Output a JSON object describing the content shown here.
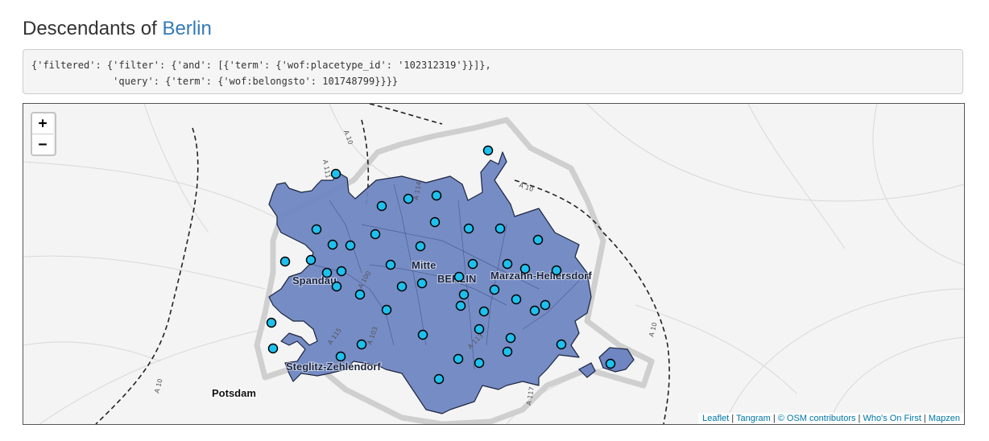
{
  "heading": {
    "prefix": "Descendants of ",
    "link": "Berlin"
  },
  "query": {
    "line1": "{'filtered': {'filter': {'and': [{'term': {'wof:placetype_id': '102312319'}}]},",
    "line2": "              'query': {'term': {'wof:belongsto': 101748799}}}}"
  },
  "map": {
    "zoom_in": "+",
    "zoom_out": "−",
    "labels": {
      "mitte": "Mitte",
      "berlin": "BERLIN",
      "spandau": "Spandau",
      "marzahn": "Marzahn-Hellersdorf",
      "steglitz": "Steglitz-Zehlendorf",
      "potsdam": "Potsdam"
    },
    "road_labels": [
      "A 10",
      "A 10",
      "A 10",
      "A 10",
      "A 111",
      "A 114",
      "A 100",
      "A 103",
      "A 113",
      "A 115",
      "A 117"
    ],
    "colors": {
      "fill": "#6f86c2",
      "marker": "#1ec1ee",
      "marker_stroke": "#000000"
    },
    "attribution": [
      "Leaflet",
      "Tangram",
      "© OSM contributors",
      "Who's On First",
      "Mapzen"
    ]
  }
}
